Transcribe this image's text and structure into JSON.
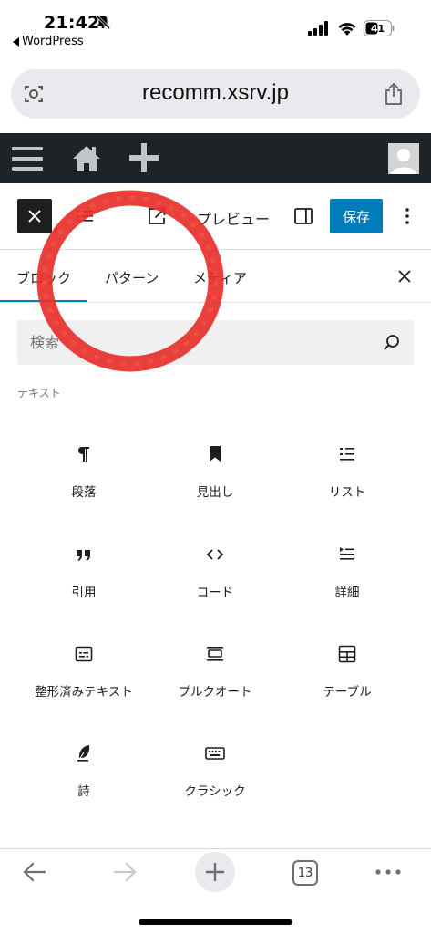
{
  "status_bar": {
    "time": "21:42",
    "back_app": "WordPress",
    "battery": "41"
  },
  "browser": {
    "url": "recomm.xsrv.jp",
    "tab_count": "13"
  },
  "editor_toolbar": {
    "preview": "プレビュー",
    "save": "保存"
  },
  "inserter": {
    "tabs": [
      "ブロック",
      "パターン",
      "メディア"
    ],
    "search_placeholder": "検索",
    "section": "テキスト",
    "blocks": [
      "段落",
      "見出し",
      "リスト",
      "引用",
      "コード",
      "詳細",
      "整形済みテキスト",
      "プルクオート",
      "テーブル",
      "詩",
      "クラシック"
    ]
  },
  "colors": {
    "accent": "#007cba",
    "admin_bar": "#1d2327",
    "annotation": "#e8302a"
  }
}
